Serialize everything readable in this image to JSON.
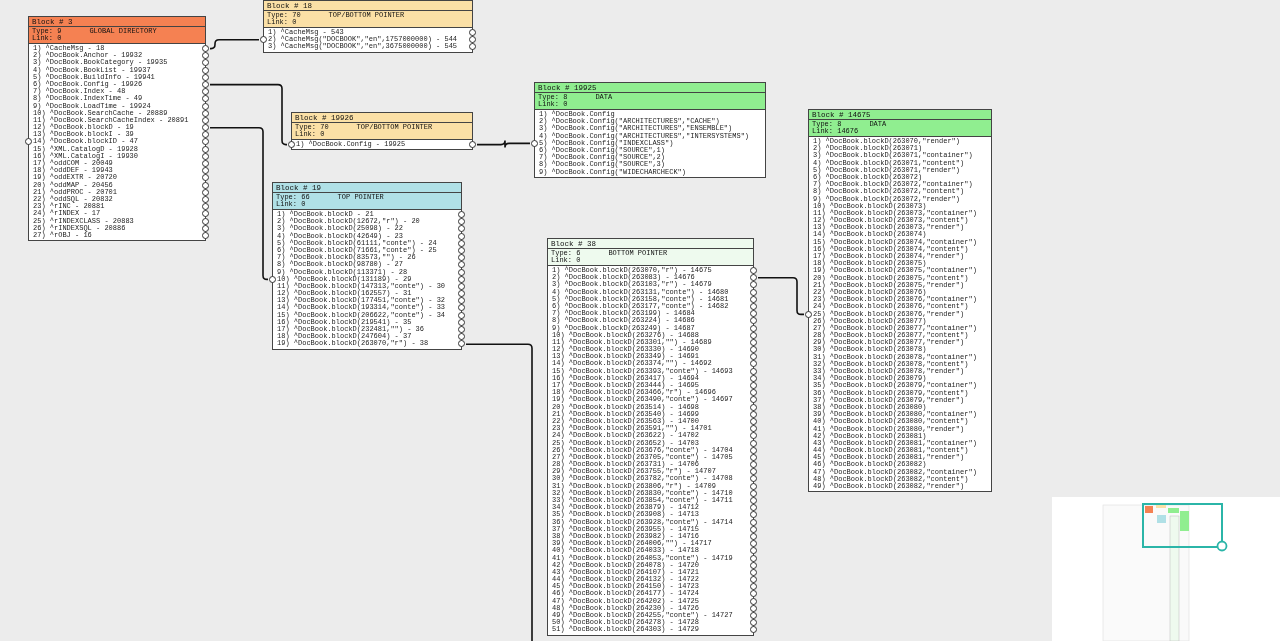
{
  "blocks": [
    {
      "title": "Block # 3",
      "type": "Type: 9",
      "label": "GLOBAL DIRECTORY",
      "link": "Link: 0",
      "color": "#f58152",
      "kind": "pointer",
      "rows": [
        {
          "text": "1) ^CacheMsg - 18",
          "in_port": false
        },
        {
          "text": "2) ^DocBook.Anchor - 19932",
          "in_port": false
        },
        {
          "text": "3) ^DocBook.BookCategory - 19935",
          "in_port": false
        },
        {
          "text": "4) ^DocBook.BookList - 19937",
          "in_port": false
        },
        {
          "text": "5) ^DocBook.BuildInfo - 19941",
          "in_port": false
        },
        {
          "text": "6) ^DocBook.Config - 19926",
          "in_port": false
        },
        {
          "text": "7) ^DocBook.Index - 48",
          "in_port": false
        },
        {
          "text": "8) ^DocBook.IndexTime - 49",
          "in_port": false
        },
        {
          "text": "9) ^DocBook.LoadTime - 19924",
          "in_port": false
        },
        {
          "text": "10) ^DocBook.SearchCache - 20889",
          "in_port": false
        },
        {
          "text": "11) ^DocBook.SearchCacheIndex - 20891",
          "in_port": false
        },
        {
          "text": "12) ^DocBook.blockD - 19",
          "in_port": false
        },
        {
          "text": "13) ^DocBook.blockI - 39",
          "in_port": false
        },
        {
          "text": "14) ^DocBook.blockID - 47",
          "in_port": true
        },
        {
          "text": "15) ^XML.CatalogD - 19928",
          "in_port": false
        },
        {
          "text": "16) ^XML.CatalogI - 19930",
          "in_port": false
        },
        {
          "text": "17) ^oddCOM - 20049",
          "in_port": false
        },
        {
          "text": "18) ^oddDEF - 19943",
          "in_port": false
        },
        {
          "text": "19) ^oddEXTR - 20720",
          "in_port": false
        },
        {
          "text": "20) ^oddMAP - 20456",
          "in_port": false
        },
        {
          "text": "21) ^oddPROC - 20701",
          "in_port": false
        },
        {
          "text": "22) ^oddSQL - 20832",
          "in_port": false
        },
        {
          "text": "23) ^rINC - 20881",
          "in_port": false
        },
        {
          "text": "24) ^rINDEX - 17",
          "in_port": false
        },
        {
          "text": "25) ^rINDEXCLASS - 20883",
          "in_port": false
        },
        {
          "text": "26) ^rINDEXSQL - 20886",
          "in_port": false
        },
        {
          "text": "27) ^rOBJ - 16",
          "in_port": false
        }
      ]
    },
    {
      "title": "Block # 18",
      "type": "Type: 70",
      "label": "TOP/BOTTOM POINTER",
      "link": "Link: 0",
      "color": "#fbe0a6",
      "kind": "pointer",
      "rows": [
        {
          "text": "1) ^CacheMsg - 543",
          "in_port": false
        },
        {
          "text": "2) ^CacheMsg(\"DOCBOOK\",\"en\",1757000000) - 544",
          "in_port": true
        },
        {
          "text": "3) ^CacheMsg(\"DOCBOOK\",\"en\",3675000000) - 545",
          "in_port": false
        }
      ]
    },
    {
      "title": "Block # 19926",
      "type": "Type: 70",
      "label": "TOP/BOTTOM POINTER",
      "link": "Link: 0",
      "color": "#fbe0a6",
      "kind": "pointer",
      "rows": [
        {
          "text": "1) ^DocBook.Config - 19925",
          "in_port": true
        }
      ]
    },
    {
      "title": "Block # 19925",
      "type": "Type: 8",
      "label": "DATA",
      "link": "Link: 0",
      "color": "#90ee90",
      "kind": "data",
      "rows": [
        {
          "text": "1) ^DocBook.Config",
          "in_port": false
        },
        {
          "text": "2) ^DocBook.Config(\"ARCHITECTURES\",\"CACHE\")",
          "in_port": false
        },
        {
          "text": "3) ^DocBook.Config(\"ARCHITECTURES\",\"ENSEMBLE\")",
          "in_port": false
        },
        {
          "text": "4) ^DocBook.Config(\"ARCHITECTURES\",\"INTERSYSTEMS\")",
          "in_port": false
        },
        {
          "text": "5) ^DocBook.Config(\"INDEXCLASS\")",
          "in_port": true
        },
        {
          "text": "6) ^DocBook.Config(\"SOURCE\",1)",
          "in_port": false
        },
        {
          "text": "7) ^DocBook.Config(\"SOURCE\",2)",
          "in_port": false
        },
        {
          "text": "8) ^DocBook.Config(\"SOURCE\",3)",
          "in_port": false
        },
        {
          "text": "9) ^DocBook.Config(\"WIDECHARCHECK\")",
          "in_port": false
        }
      ]
    },
    {
      "title": "Block # 19",
      "type": "Type: 66",
      "label": "TOP POINTER",
      "link": "Link: 0",
      "color": "#b0e0e6",
      "kind": "pointer",
      "rows": [
        {
          "text": "1) ^DocBook.blockD - 21",
          "in_port": false
        },
        {
          "text": "2) ^DocBook.blockD(12672,\"r\") - 20",
          "in_port": false
        },
        {
          "text": "3) ^DocBook.blockD(25098) - 22",
          "in_port": false
        },
        {
          "text": "4) ^DocBook.blockD(42649) - 23",
          "in_port": false
        },
        {
          "text": "5) ^DocBook.blockD(61111,\"conte\") - 24",
          "in_port": false
        },
        {
          "text": "6) ^DocBook.blockD(71661,\"conte\") - 25",
          "in_port": false
        },
        {
          "text": "7) ^DocBook.blockD(83573,\"\") - 26",
          "in_port": false
        },
        {
          "text": "8) ^DocBook.blockD(98780) - 27",
          "in_port": false
        },
        {
          "text": "9) ^DocBook.blockD(113371) - 28",
          "in_port": false
        },
        {
          "text": "10) ^DocBook.blockD(131189) - 29",
          "in_port": true
        },
        {
          "text": "11) ^DocBook.blockD(147313,\"conte\") - 30",
          "in_port": false
        },
        {
          "text": "12) ^DocBook.blockD(162557) - 31",
          "in_port": false
        },
        {
          "text": "13) ^DocBook.blockD(177451,\"conte\") - 32",
          "in_port": false
        },
        {
          "text": "14) ^DocBook.blockD(193314,\"conte\") - 33",
          "in_port": false
        },
        {
          "text": "15) ^DocBook.blockD(206622,\"conte\") - 34",
          "in_port": false
        },
        {
          "text": "16) ^DocBook.blockD(219541) - 35",
          "in_port": false
        },
        {
          "text": "17) ^DocBook.blockD(232481,\"\") - 36",
          "in_port": false
        },
        {
          "text": "18) ^DocBook.blockD(247604) - 37",
          "in_port": false
        },
        {
          "text": "19) ^DocBook.blockD(263070,\"r\") - 38",
          "in_port": false
        }
      ]
    },
    {
      "title": "Block # 38",
      "type": "Type: 6",
      "label": "BOTTOM POINTER",
      "link": "Link: 0",
      "color": "#eefaee",
      "kind": "pointer",
      "rows": [
        {
          "text": "1) ^DocBook.blockD(263070,\"r\") - 14675",
          "in_port": false
        },
        {
          "text": "2) ^DocBook.blockD(263083) - 14676",
          "in_port": false
        },
        {
          "text": "3) ^DocBook.blockD(263103,\"r\") - 14679",
          "in_port": false
        },
        {
          "text": "4) ^DocBook.blockD(263131,\"conte\") - 14680",
          "in_port": false
        },
        {
          "text": "5) ^DocBook.blockD(263158,\"conte\") - 14681",
          "in_port": false
        },
        {
          "text": "6) ^DocBook.blockD(263177,\"conte\") - 14682",
          "in_port": false
        },
        {
          "text": "7) ^DocBook.blockD(263199) - 14684",
          "in_port": false
        },
        {
          "text": "8) ^DocBook.blockD(263224) - 14686",
          "in_port": false
        },
        {
          "text": "9) ^DocBook.blockD(263249) - 14687",
          "in_port": false
        },
        {
          "text": "10) ^DocBook.blockD(263276) - 14688",
          "in_port": false
        },
        {
          "text": "11) ^DocBook.blockD(263301,\"\") - 14689",
          "in_port": false
        },
        {
          "text": "12) ^DocBook.blockD(263330) - 14690",
          "in_port": false
        },
        {
          "text": "13) ^DocBook.blockD(263349) - 14691",
          "in_port": false
        },
        {
          "text": "14) ^DocBook.blockD(263374,\"\") - 14692",
          "in_port": false
        },
        {
          "text": "15) ^DocBook.blockD(263393,\"conte\") - 14693",
          "in_port": false
        },
        {
          "text": "16) ^DocBook.blockD(263417) - 14694",
          "in_port": false
        },
        {
          "text": "17) ^DocBook.blockD(263444) - 14695",
          "in_port": false
        },
        {
          "text": "18) ^DocBook.blockD(263466,\"r\") - 14696",
          "in_port": false
        },
        {
          "text": "19) ^DocBook.blockD(263490,\"conte\") - 14697",
          "in_port": false
        },
        {
          "text": "20) ^DocBook.blockD(263514) - 14698",
          "in_port": false
        },
        {
          "text": "21) ^DocBook.blockD(263540) - 14699",
          "in_port": false
        },
        {
          "text": "22) ^DocBook.blockD(263563) - 14700",
          "in_port": false
        },
        {
          "text": "23) ^DocBook.blockD(263591,\"\") - 14701",
          "in_port": false
        },
        {
          "text": "24) ^DocBook.blockD(263622) - 14702",
          "in_port": false
        },
        {
          "text": "25) ^DocBook.blockD(263652) - 14703",
          "in_port": false
        },
        {
          "text": "26) ^DocBook.blockD(263676,\"conte\") - 14704",
          "in_port": false
        },
        {
          "text": "27) ^DocBook.blockD(263705,\"conte\") - 14705",
          "in_port": false
        },
        {
          "text": "28) ^DocBook.blockD(263731) - 14706",
          "in_port": false
        },
        {
          "text": "29) ^DocBook.blockD(263755,\"r\") - 14707",
          "in_port": false
        },
        {
          "text": "30) ^DocBook.blockD(263782,\"conte\") - 14708",
          "in_port": false
        },
        {
          "text": "31) ^DocBook.blockD(263806,\"r\") - 14709",
          "in_port": false
        },
        {
          "text": "32) ^DocBook.blockD(263830,\"conte\") - 14710",
          "in_port": false
        },
        {
          "text": "33) ^DocBook.blockD(263854,\"conte\") - 14711",
          "in_port": false
        },
        {
          "text": "34) ^DocBook.blockD(263879) - 14712",
          "in_port": false
        },
        {
          "text": "35) ^DocBook.blockD(263908) - 14713",
          "in_port": false
        },
        {
          "text": "36) ^DocBook.blockD(263928,\"conte\") - 14714",
          "in_port": false
        },
        {
          "text": "37) ^DocBook.blockD(263955) - 14715",
          "in_port": false
        },
        {
          "text": "38) ^DocBook.blockD(263982) - 14716",
          "in_port": false
        },
        {
          "text": "39) ^DocBook.blockD(264006,\"\") - 14717",
          "in_port": false
        },
        {
          "text": "40) ^DocBook.blockD(264033) - 14718",
          "in_port": false
        },
        {
          "text": "41) ^DocBook.blockD(264053,\"conte\") - 14719",
          "in_port": false
        },
        {
          "text": "42) ^DocBook.blockD(264078) - 14720",
          "in_port": false
        },
        {
          "text": "43) ^DocBook.blockD(264107) - 14721",
          "in_port": false
        },
        {
          "text": "44) ^DocBook.blockD(264132) - 14722",
          "in_port": false
        },
        {
          "text": "45) ^DocBook.blockD(264150) - 14723",
          "in_port": false
        },
        {
          "text": "46) ^DocBook.blockD(264177) - 14724",
          "in_port": false
        },
        {
          "text": "47) ^DocBook.blockD(264202) - 14725",
          "in_port": false
        },
        {
          "text": "48) ^DocBook.blockD(264230) - 14726",
          "in_port": false
        },
        {
          "text": "49) ^DocBook.blockD(264255,\"conte\") - 14727",
          "in_port": false
        },
        {
          "text": "50) ^DocBook.blockD(264278) - 14728",
          "in_port": false
        },
        {
          "text": "51) ^DocBook.blockD(264303) - 14729",
          "in_port": false
        }
      ]
    },
    {
      "title": "Block # 14675",
      "type": "Type: 8",
      "label": "DATA",
      "link": "Link: 14676",
      "color": "#90ee90",
      "kind": "data",
      "rows": [
        {
          "text": "1) ^DocBook.blockD(263070,\"render\")",
          "in_port": false
        },
        {
          "text": "2) ^DocBook.blockD(263071)",
          "in_port": false
        },
        {
          "text": "3) ^DocBook.blockD(263071,\"container\")",
          "in_port": false
        },
        {
          "text": "4) ^DocBook.blockD(263071,\"content\")",
          "in_port": false
        },
        {
          "text": "5) ^DocBook.blockD(263071,\"render\")",
          "in_port": false
        },
        {
          "text": "6) ^DocBook.blockD(263072)",
          "in_port": false
        },
        {
          "text": "7) ^DocBook.blockD(263072,\"container\")",
          "in_port": false
        },
        {
          "text": "8) ^DocBook.blockD(263072,\"content\")",
          "in_port": false
        },
        {
          "text": "9) ^DocBook.blockD(263072,\"render\")",
          "in_port": false
        },
        {
          "text": "10) ^DocBook.blockD(263073)",
          "in_port": false
        },
        {
          "text": "11) ^DocBook.blockD(263073,\"container\")",
          "in_port": false
        },
        {
          "text": "12) ^DocBook.blockD(263073,\"content\")",
          "in_port": false
        },
        {
          "text": "13) ^DocBook.blockD(263073,\"render\")",
          "in_port": false
        },
        {
          "text": "14) ^DocBook.blockD(263074)",
          "in_port": false
        },
        {
          "text": "15) ^DocBook.blockD(263074,\"container\")",
          "in_port": false
        },
        {
          "text": "16) ^DocBook.blockD(263074,\"content\")",
          "in_port": false
        },
        {
          "text": "17) ^DocBook.blockD(263074,\"render\")",
          "in_port": false
        },
        {
          "text": "18) ^DocBook.blockD(263075)",
          "in_port": false
        },
        {
          "text": "19) ^DocBook.blockD(263075,\"container\")",
          "in_port": false
        },
        {
          "text": "20) ^DocBook.blockD(263075,\"content\")",
          "in_port": false
        },
        {
          "text": "21) ^DocBook.blockD(263075,\"render\")",
          "in_port": false
        },
        {
          "text": "22) ^DocBook.blockD(263076)",
          "in_port": false
        },
        {
          "text": "23) ^DocBook.blockD(263076,\"container\")",
          "in_port": false
        },
        {
          "text": "24) ^DocBook.blockD(263076,\"content\")",
          "in_port": false
        },
        {
          "text": "25) ^DocBook.blockD(263076,\"render\")",
          "in_port": true
        },
        {
          "text": "26) ^DocBook.blockD(263077)",
          "in_port": false
        },
        {
          "text": "27) ^DocBook.blockD(263077,\"container\")",
          "in_port": false
        },
        {
          "text": "28) ^DocBook.blockD(263077,\"content\")",
          "in_port": false
        },
        {
          "text": "29) ^DocBook.blockD(263077,\"render\")",
          "in_port": false
        },
        {
          "text": "30) ^DocBook.blockD(263078)",
          "in_port": false
        },
        {
          "text": "31) ^DocBook.blockD(263078,\"container\")",
          "in_port": false
        },
        {
          "text": "32) ^DocBook.blockD(263078,\"content\")",
          "in_port": false
        },
        {
          "text": "33) ^DocBook.blockD(263078,\"render\")",
          "in_port": false
        },
        {
          "text": "34) ^DocBook.blockD(263079)",
          "in_port": false
        },
        {
          "text": "35) ^DocBook.blockD(263079,\"container\")",
          "in_port": false
        },
        {
          "text": "36) ^DocBook.blockD(263079,\"content\")",
          "in_port": false
        },
        {
          "text": "37) ^DocBook.blockD(263079,\"render\")",
          "in_port": false
        },
        {
          "text": "38) ^DocBook.blockD(263080)",
          "in_port": false
        },
        {
          "text": "39) ^DocBook.blockD(263080,\"container\")",
          "in_port": false
        },
        {
          "text": "40) ^DocBook.blockD(263080,\"content\")",
          "in_port": false
        },
        {
          "text": "41) ^DocBook.blockD(263080,\"render\")",
          "in_port": false
        },
        {
          "text": "42) ^DocBook.blockD(263081)",
          "in_port": false
        },
        {
          "text": "43) ^DocBook.blockD(263081,\"container\")",
          "in_port": false
        },
        {
          "text": "44) ^DocBook.blockD(263081,\"content\")",
          "in_port": false
        },
        {
          "text": "45) ^DocBook.blockD(263081,\"render\")",
          "in_port": false
        },
        {
          "text": "46) ^DocBook.blockD(263082)",
          "in_port": false
        },
        {
          "text": "47) ^DocBook.blockD(263082,\"container\")",
          "in_port": false
        },
        {
          "text": "48) ^DocBook.blockD(263082,\"content\")",
          "in_port": false
        },
        {
          "text": "49) ^DocBook.blockD(263082,\"render\")",
          "in_port": false
        }
      ]
    }
  ]
}
